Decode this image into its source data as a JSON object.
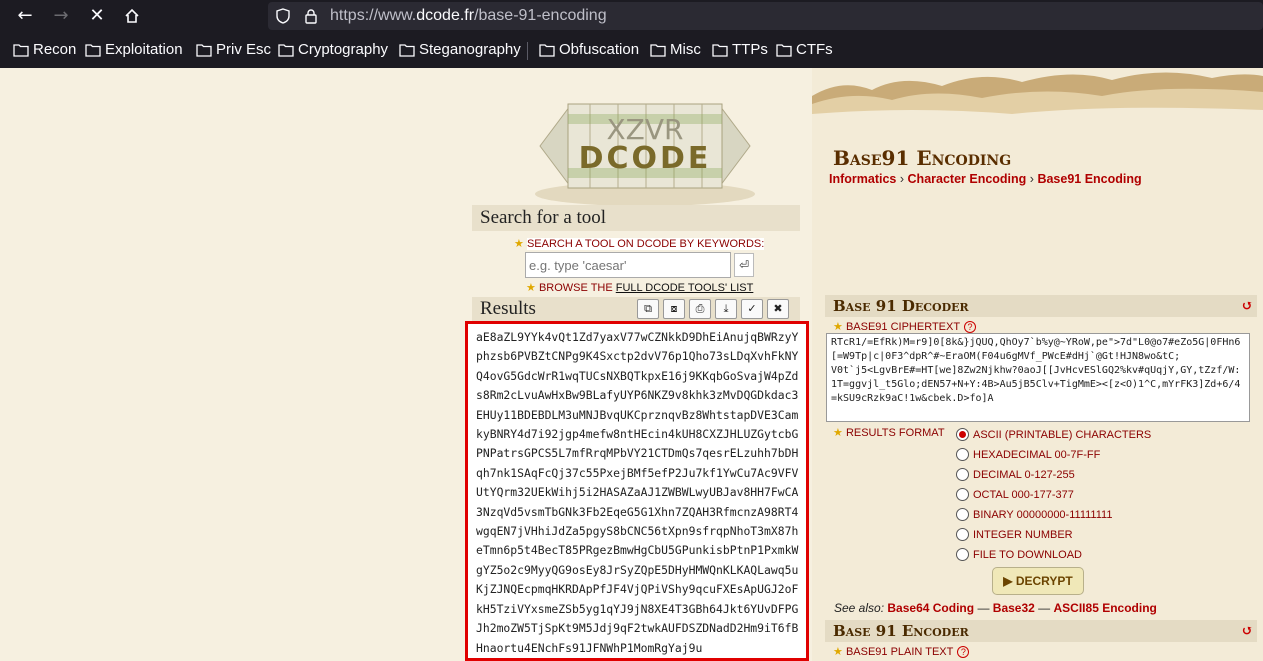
{
  "browser": {
    "url_prefix": "https://www.",
    "url_domain": "dcode.fr",
    "url_path": "/base-91-encoding",
    "bookmarks": [
      "Recon",
      "Exploitation",
      "Priv Esc",
      "Cryptography",
      "Steganography",
      "Obfuscation",
      "Misc",
      "TTPs",
      "CTFs"
    ]
  },
  "logo": {
    "text": "DCODE"
  },
  "search": {
    "title": "Search for a tool",
    "keywords_label": "SEARCH A TOOL ON DCODE BY KEYWORDS:",
    "placeholder": "e.g. type 'caesar'",
    "go_icon": "⏎",
    "browse_prefix": "BROWSE THE ",
    "browse_link": "FULL DCODE TOOLS' LIST"
  },
  "results": {
    "title": "Results",
    "tool_icons": [
      "⧉",
      "⧇",
      "⎙",
      "⤓",
      "✓",
      "✖"
    ],
    "text": "aE8aZL9YYk4vQt1Zd7yaxV77wCZNkkD9DhEiAnujqBWRzyYphzsb6PVBZtCNPg9K4Sxctp2dvV76p1Qho73sLDqXvhFkNYQ4ovG5GdcWrR1wqTUCsNXBQTkpxE16j9KKqbGoSvajW4pZds8Rm2cLvuAwHxBw9BLafyUYP6NKZ9v8khk3zMvDQGDkdac3EHUy11BDEBDLM3uMNJBvqUKCprznqvBz8WhtstapDVE3CamkyBNRY4d7i92jgp4mefw8ntHEcin4kUH8CXZJHLUZGytcbGPNPatrsGPCS5L7mfRrqMPbVY21CTDmQs7qesrELzuhh7bDHqh7nk1SAqFcQj37c55PxejBMf5efP2Ju7kf1YwCu7Ac9VFVUtYQrm32UEkWihj5i2HASAZaAJ1ZWBWLwyUBJav8HH7FwCA3NzqVd5vsmTbGNk3Fb2EqeG5G1Xhn7ZQAH3RfmcnzA98RT4wgqEN7jVHhiJdZa5pgyS8bCNC56tXpn9sfrqpNhoT3mX87heTmn6p5t4BecT85PRgezBmwHgCbU5GPunkisbPtnP1PxmkWgYZ5o2c9MyyQG9osEy8JrSyZQpE5DHyHMWQnKLKAQLawq5uKjZJNQEcpmqHKRDApPfJF4VjQPiVShy9qcuFXEsApUGJ2oFkH5TziVYxsmeZSb5yg1qYJ9jN8XE4T3GBh64Jkt6YUvDFPGJh2moZW5TjSpKt9M5Jdj9qF2twkAUFDSZDNadD2Hm9iT6fBHnaortu4ENchFs91JFNWhP1MomRgYaj9u"
  },
  "page": {
    "title": "Base91 Encoding",
    "breadcrumbs": [
      "Informatics",
      "Character Encoding",
      "Base91 Encoding"
    ],
    "crumb_sep": "›"
  },
  "decoder": {
    "title": "Base 91 Decoder",
    "refresh_icon": "↺",
    "cipher_label": "BASE91 CIPHERTEXT",
    "help_icon": "?",
    "ciphertext": "RTcR1/=EfRk)M=r9]0[8k&}jQUQ,QhOy7`b%y@~YRoW,pe\">7d\"L0@o7#eZo5G|0FHn6[=W9Tp|c|0F3^dpR^#~EraOM(F04u6gMVf_PWcE#dHj`@Gt!HJN8wo&tC;\nV0t`j5<LgvBrE#=HT[we]8Zw2Njkhw?0aoJ[[JvHcvESlGQ2%kv#qUqjY,GY,tZzf/W:1T=ggvjl_t5Glo;dEN57+N+Y:4B>Au5jB5Clv+TigMmE><[z<O)1^C,mYrFK3]Zd+6/4=kSU9cRzk9aC!1w&cbek.D>fo]A",
    "format_label": "RESULTS FORMAT",
    "options": [
      {
        "label": "ASCII (PRINTABLE) CHARACTERS",
        "selected": true
      },
      {
        "label": "HEXADECIMAL 00-7F-FF",
        "selected": false
      },
      {
        "label": "DECIMAL 0-127-255",
        "selected": false
      },
      {
        "label": "OCTAL 000-177-377",
        "selected": false
      },
      {
        "label": "BINARY 00000000-11111111",
        "selected": false
      },
      {
        "label": "INTEGER NUMBER",
        "selected": false
      },
      {
        "label": "FILE TO DOWNLOAD",
        "selected": false
      }
    ],
    "decrypt_label": "▶ DECRYPT",
    "see_also_label": "See also:",
    "see_also": [
      "Base64 Coding",
      "Base32",
      "ASCII85 Encoding"
    ],
    "see_also_sep": "—"
  },
  "encoder": {
    "title": "Base 91 Encoder",
    "refresh_icon": "↺",
    "plain_label": "BASE91 PLAIN TEXT",
    "help_icon": "?"
  }
}
